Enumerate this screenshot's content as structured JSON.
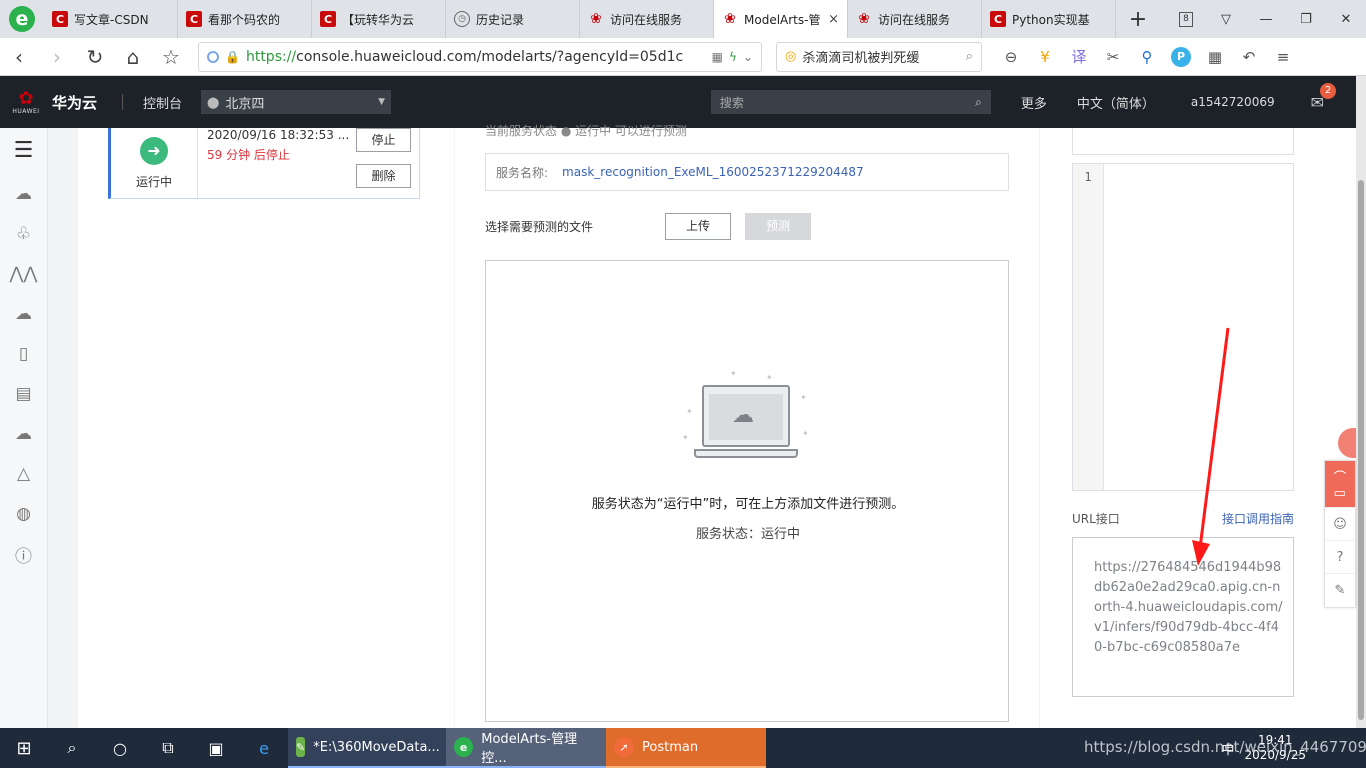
{
  "browser": {
    "tabs": [
      {
        "label": "写文章-CSDN",
        "icon": "csdn",
        "active": false
      },
      {
        "label": "看那个码农的",
        "icon": "csdn",
        "active": false
      },
      {
        "label": "【玩转华为云",
        "icon": "csdn",
        "active": false
      },
      {
        "label": "历史记录",
        "icon": "history",
        "active": false
      },
      {
        "label": "访问在线服务",
        "icon": "huawei",
        "active": false
      },
      {
        "label": "ModelArts-管",
        "icon": "huawei",
        "active": true
      },
      {
        "label": "访问在线服务",
        "icon": "huawei",
        "active": false
      },
      {
        "label": "Python实现基",
        "icon": "csdn",
        "active": false
      }
    ],
    "tab_count": "8",
    "url_scheme": "https://",
    "url_rest": "console.huaweicloud.com/modelarts/?agencyId=05d1c",
    "search_text": "杀滴滴司机被判死缓",
    "close_tab_symbol": "×"
  },
  "console_header": {
    "brand_mark": "HUAWEI",
    "brand": "华为云",
    "console": "控制台",
    "region": "北京四",
    "search_placeholder": "搜索",
    "more": "更多",
    "language": "中文（简体）",
    "user": "a1542720069",
    "mail_badge": "2"
  },
  "service_card": {
    "status": "运行中",
    "time": "2020/09/16 18:32:53 ...",
    "remaining": "59 分钟 后停止",
    "stop_label": "停止",
    "delete_label": "删除"
  },
  "predict": {
    "top_cut_text": "当前服务状态  ● 运行中  可以进行预测",
    "service_name_key": "服务名称:",
    "service_name_value": "mask_recognition_ExeML_1600252371229204487",
    "pick_label": "选择需要预测的文件",
    "upload_label": "上传",
    "predict_label": "预测",
    "drop_message": "服务状态为“运行中”时，可在上方添加文件进行预测。",
    "drop_status": "服务状态：运行中"
  },
  "response": {
    "line_number": "1",
    "url_label": "URL接口",
    "guide_link": "接口调用指南",
    "url_value": "https://276484546d1944b98db62a0e2ad29ca0.apig.cn-north-4.huaweicloudapis.com/v1/infers/f90d79db-4bcc-4f40-b7bc-c69c08580a7e"
  },
  "taskbar": {
    "apps": [
      {
        "label": "*E:\\360MoveData...",
        "icon": "notepad"
      },
      {
        "label": "ModelArts-管理控...",
        "icon": "browser-360"
      },
      {
        "label": "Postman",
        "icon": "postman"
      }
    ],
    "ime": "中",
    "time": "19:41",
    "date": "2020/9/25"
  },
  "watermark": "https://blog.csdn.net/weixin_44677099",
  "colors": {
    "huawei_red": "#c7000b",
    "running_green": "#3cba7e",
    "link_blue": "#3a63b8",
    "header_dark": "#1d2229",
    "arrow_red": "#ff1a1a"
  }
}
